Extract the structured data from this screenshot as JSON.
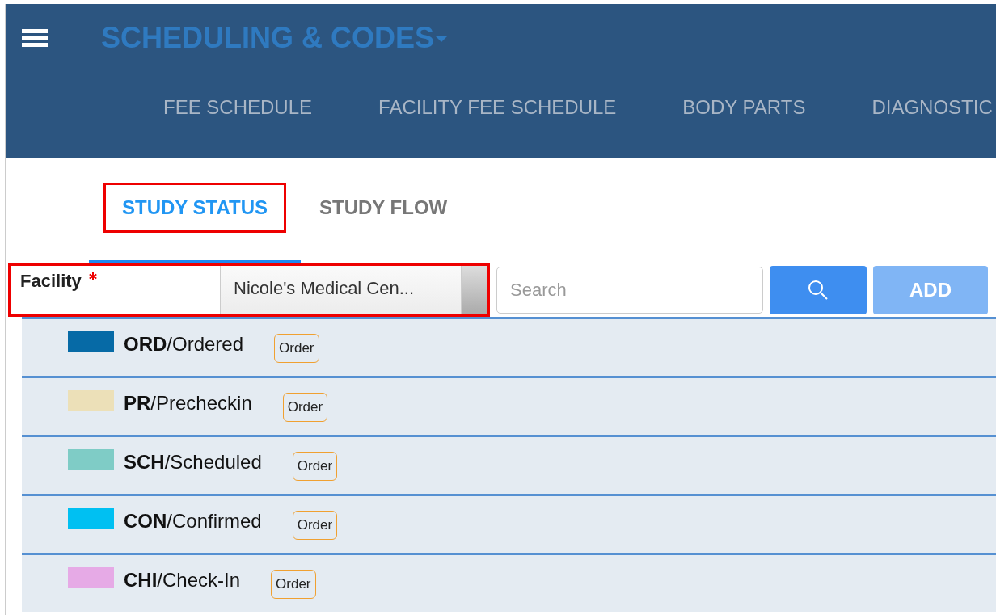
{
  "header": {
    "title": "SCHEDULING & CODES",
    "nav": [
      {
        "label": "FEE SCHEDULE"
      },
      {
        "label": "FACILITY FEE SCHEDULE"
      },
      {
        "label": "BODY PARTS"
      },
      {
        "label": "DIAGNOSTIC"
      }
    ]
  },
  "tabs": [
    {
      "label": "STUDY STATUS",
      "selected": true,
      "highlighted": true
    },
    {
      "label": "STUDY FLOW",
      "selected": false,
      "highlighted": false
    }
  ],
  "facility": {
    "label": "Facility",
    "required": true,
    "value": "Nicole's Medical Cen...",
    "highlighted": true
  },
  "search": {
    "placeholder": "Search"
  },
  "add_button": "ADD",
  "statuses": [
    {
      "text": "**ORD**/Ordered",
      "color": "#066aa6",
      "badge": "Order"
    },
    {
      "text": "**PR**/Precheckin",
      "color": "#ece0b8",
      "badge": "Order"
    },
    {
      "text": "**SCH**/Scheduled",
      "color": "#7fccc6",
      "badge": "Order"
    },
    {
      "text": "**CON**/Confirmed",
      "color": "#00c0f2",
      "badge": "Order"
    },
    {
      "text": "**CHI**/Check-In",
      "color": "#e6aae6",
      "badge": "Order"
    }
  ]
}
